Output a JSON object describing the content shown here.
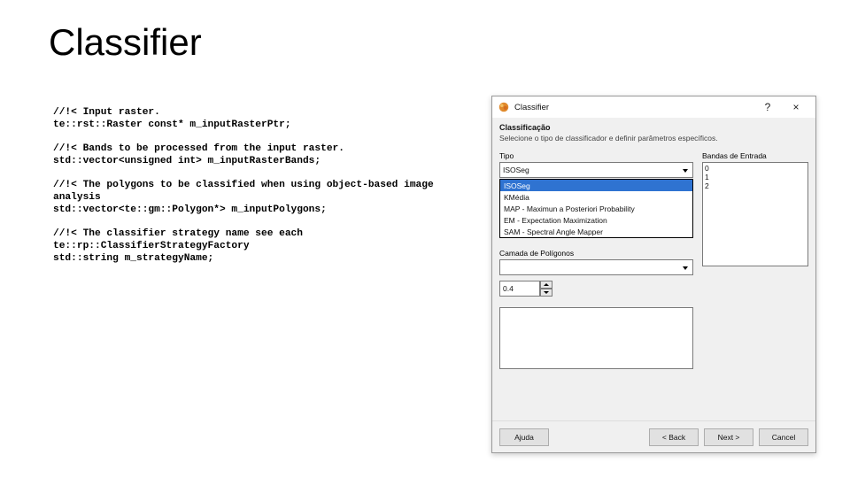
{
  "title": "Classifier",
  "code": {
    "p1a": "//!< Input raster.",
    "p1b": "te::rst::Raster const* m_inputRasterPtr;",
    "p2a": "//!< Bands to be processed from the input raster.",
    "p2b": "std::vector<unsigned int> m_inputRasterBands;",
    "p3a": "//!< The polygons to be classified when using object-based image analysis",
    "p3b": "std::vector<te::gm::Polygon*> m_inputPolygons;",
    "p4a": "//!< The classifier strategy name see each te::rp::ClassifierStrategyFactory",
    "p4b": "std::string m_strategyName;"
  },
  "dialog": {
    "title": "Classifier",
    "section_title": "Classificação",
    "section_sub": "Selecione o tipo de classificador e definir parâmetros específicos.",
    "tipo_label": "Tipo",
    "tipo_value": "ISOSeg",
    "options": [
      "ISOSeg",
      "KMédia",
      "MAP - Maximun a Posteriori Probability",
      "EM - Expectation Maximization",
      "SAM - Spectral Angle Mapper"
    ],
    "bandas_label": "Bandas de Entrada",
    "bandas": [
      "0",
      "1",
      "2"
    ],
    "camada_label": "Camada de Polígonos",
    "num_value": "0.4",
    "btn_help": "Ajuda",
    "btn_back": "< Back",
    "btn_next": "Next >",
    "btn_cancel": "Cancel"
  }
}
